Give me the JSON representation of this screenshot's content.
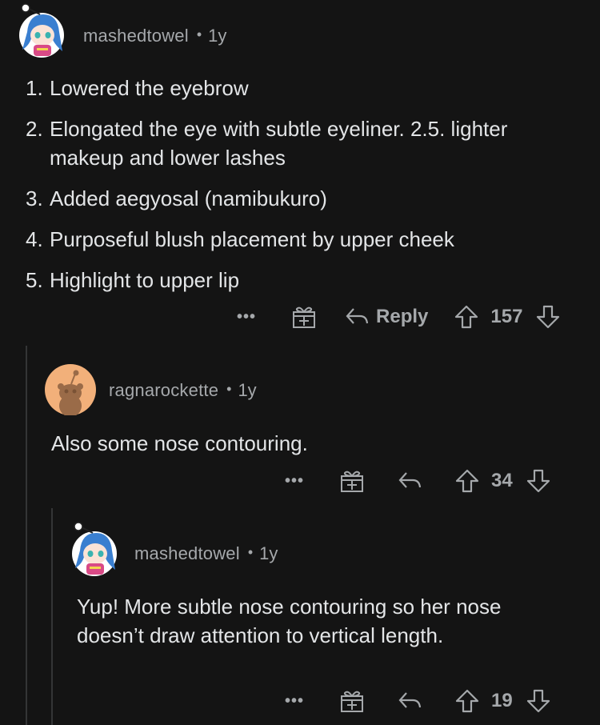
{
  "comments": [
    {
      "username": "mashedtowel",
      "separator": "•",
      "age": "1y",
      "points": [
        {
          "num": "1.",
          "text": "Lowered the eyebrow"
        },
        {
          "num": "2.",
          "text": "Elongated the eye with subtle eyeliner. 2.5. lighter makeup and lower lashes"
        },
        {
          "num": "3.",
          "text": "Added aegyosal (namibukuro)"
        },
        {
          "num": "4.",
          "text": "Purposeful blush placement by upper cheek"
        },
        {
          "num": "5.",
          "text": "Highlight to upper lip"
        }
      ],
      "actions": {
        "more": "•••",
        "reply_label": "Reply",
        "votes": "157"
      }
    },
    {
      "username": "ragnarockette",
      "separator": "•",
      "age": "1y",
      "text": "Also some nose contouring.",
      "actions": {
        "more": "•••",
        "votes": "34"
      }
    },
    {
      "username": "mashedtowel",
      "separator": "•",
      "age": "1y",
      "text": "Yup! More subtle nose contouring so her nose doesn’t draw attention to vertical length.",
      "actions": {
        "more": "•••",
        "votes": "19"
      }
    }
  ],
  "icons": {
    "more": "more-options-icon",
    "award": "award-gift-icon",
    "reply": "reply-arrow-icon",
    "upvote": "upvote-arrow-icon",
    "downvote": "downvote-arrow-icon"
  },
  "colors": {
    "background": "#141414",
    "text": "#e3e5e7",
    "muted": "#a5a8ab",
    "thread_line": "#343536"
  }
}
